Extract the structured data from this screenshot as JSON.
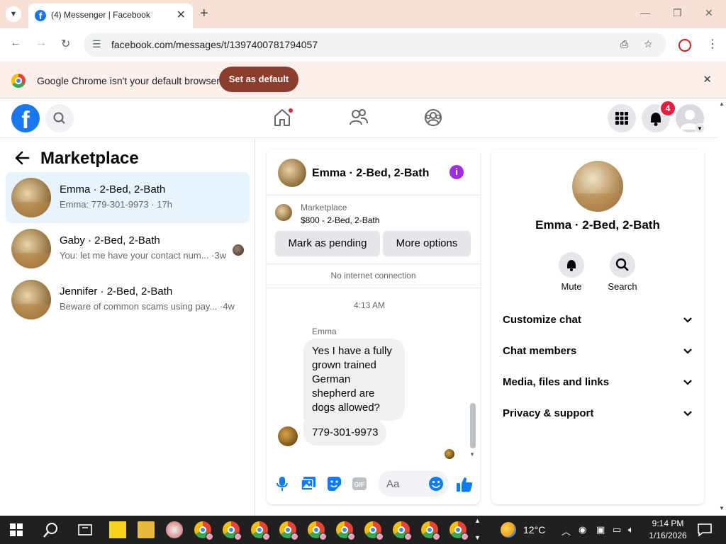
{
  "browser": {
    "tab_title": "(4) Messenger | Facebook",
    "url": "facebook.com/messages/t/1397400781794057",
    "infobar": {
      "message": "Google Chrome isn't your default browser",
      "button": "Set as default"
    }
  },
  "fb_header": {
    "logo": "f",
    "notification_count": "4"
  },
  "left_pane": {
    "title": "Marketplace",
    "conversations": [
      {
        "name": "Emma · 2-Bed, 2-Bath",
        "snippet": "Emma: 779-301-9973 · 17h",
        "active": true
      },
      {
        "name": "Gaby · 2-Bed, 2-Bath",
        "snippet": "You: let me have your contact num... ·3w"
      },
      {
        "name": "Jennifer · 2-Bed, 2-Bath",
        "snippet": "Beware of common scams using pay...  ·4w"
      }
    ]
  },
  "chat": {
    "title": "Emma · 2-Bed, 2-Bath",
    "marketplace_label": "Marketplace",
    "listing": "$800 - 2-Bed, 2-Bath",
    "mark_pending": "Mark as pending",
    "more_options": "More options",
    "connection_status": "No internet connection",
    "timestamp": "4:13 AM",
    "sender": "Emma",
    "messages": [
      "Yes I have a fully grown trained German shepherd are dogs allowed?",
      "779-301-9973"
    ],
    "input_placeholder": "Aa"
  },
  "details": {
    "name": "Emma · 2-Bed, 2-Bath",
    "actions": [
      "Mute",
      "Search"
    ],
    "sections": [
      "Customize chat",
      "Chat members",
      "Media, files and links",
      "Privacy & support"
    ]
  },
  "taskbar": {
    "temperature": "12°C",
    "time": "9:14 PM",
    "date": "1/16/2026"
  },
  "colors": {
    "facebook_blue": "#1877f2",
    "infobar_button": "#8c3d2b",
    "notification_red": "#e41e3f",
    "info_purple": "#9f2de8"
  }
}
